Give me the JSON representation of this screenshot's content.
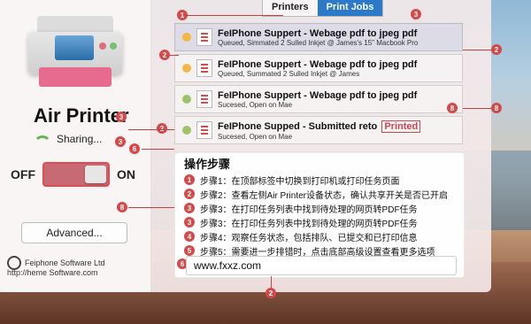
{
  "app": {
    "title": "Air Printer",
    "status": "Sharing...",
    "switch": {
      "off_label": "OFF",
      "on_label": "ON"
    },
    "advanced_label": "Advanced...",
    "brand": {
      "name": "Feiphone Software Ltd",
      "url": "http://heme Software.com"
    }
  },
  "tabs": [
    {
      "label": "Printers"
    },
    {
      "label": "Print Jobs",
      "active": true
    }
  ],
  "jobs": [
    {
      "name": "FeIPhone Suppert - Webage pdf to jpeg pdf",
      "sub": "Queued,   Simmated 2 Sulled Inkjet @ James's 15\" Macbook Pro"
    },
    {
      "name": "FeIPhone Suppert - Webage pdf to jpeg pdf",
      "sub": "Queued,   Summated 2 Sulled Inkjet @ James"
    },
    {
      "name": "FeIPhone Suppert - Webage pdf to jpeg pdf",
      "sub": "Sucesed, Open on Mae"
    },
    {
      "name": "FeIPhone Supped - Submitted reto",
      "printed": "Printed",
      "sub": "Sucesed, Open on Mae"
    }
  ],
  "overlay": {
    "title": "操作步骤",
    "steps": [
      {
        "num": "1",
        "text": "步骤1：在顶部标签中切换到打印机或打印任务页面"
      },
      {
        "num": "2",
        "text": "步骤2：查看左侧Air Printer设备状态，确认共享开关是否已开启"
      },
      {
        "num": "3",
        "text": "步骤3：在打印任务列表中找到待处理的网页转PDF任务"
      },
      {
        "num": "3",
        "text": "步骤3：在打印任务列表中找到待处理的网页转PDF任务"
      },
      {
        "num": "4",
        "text": "步骤4：观察任务状态，包括排队、已提交和已打印信息"
      },
      {
        "num": "5",
        "text": "步骤5：需要进一步排错时，点击底部高级设置查看更多选项"
      }
    ],
    "url_label": "www.fxxz.com",
    "url_badge": "6"
  },
  "badges": {
    "b1": "1",
    "b2": "2",
    "b3": "3",
    "b4": "2",
    "b5": "8",
    "b6": "8",
    "b7": "3",
    "b8": "6",
    "b9": "8",
    "b10": "2",
    "b11": "2",
    "b12": "3"
  },
  "colors": {
    "accent": "#2c79c9",
    "annotation": "#d44a4a",
    "panel": "#f4e9e9"
  }
}
